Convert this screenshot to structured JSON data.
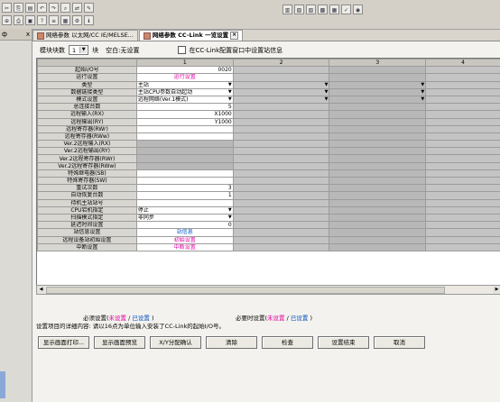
{
  "toolbar": {
    "left_icons": [
      "cut-icon",
      "copy-icon",
      "paste-icon",
      "undo-icon",
      "redo-icon",
      "find-icon",
      "replace-icon",
      "comment-icon",
      "zoom-icon",
      "print-icon",
      "save-icon",
      "help-icon",
      "list-icon",
      "grid-icon",
      "settings-icon",
      "info-icon"
    ],
    "right_icons": [
      "ladder-icon",
      "io-icon",
      "device-icon",
      "network-icon",
      "param-icon",
      "check-icon",
      "monitor-icon"
    ]
  },
  "left_pane": {
    "header": "ф x"
  },
  "tabs": [
    {
      "label": "网络参数 以太网/CC IE/MELSE...",
      "active": false
    },
    {
      "label": "网络参数 CC-Link 一览设置",
      "active": true
    }
  ],
  "top": {
    "module_count_label": "模块块数",
    "module_count_value": "1",
    "unit_label": "块",
    "blank_label": "空白:无设置",
    "checkbox_label": "在CC-Link配置窗口中设置站信息"
  },
  "columns": [
    "1",
    "2",
    "3",
    "4"
  ],
  "rows": [
    {
      "label": "起始I/O号",
      "c1": "0020",
      "type": "num"
    },
    {
      "label": "运行设置",
      "c1": "运行设置",
      "type": "pink"
    },
    {
      "label": "类型",
      "c1": "主站",
      "type": "dd"
    },
    {
      "label": "数据链接类型",
      "c1": "主站CPU参数自动起动",
      "type": "dd"
    },
    {
      "label": "模式设置",
      "c1": "远程网络(Ver.1模式)",
      "type": "dd"
    },
    {
      "label": "总连接台数",
      "c1": "5",
      "type": "num"
    },
    {
      "label": "远程输入(RX)",
      "c1": "X1000",
      "type": "num"
    },
    {
      "label": "远程输出(RY)",
      "c1": "Y1000",
      "type": "num"
    },
    {
      "label": "远程寄存器(RWr)",
      "c1": "",
      "type": "w"
    },
    {
      "label": "远程寄存器(RWw)",
      "c1": "",
      "type": "w"
    },
    {
      "label": "Ver.2远程输入(RX)",
      "c1": "",
      "type": "g"
    },
    {
      "label": "Ver.2远程输出(RY)",
      "c1": "",
      "type": "g"
    },
    {
      "label": "Ver.2远程寄存器(RWr)",
      "c1": "",
      "type": "g"
    },
    {
      "label": "Ver.2远程寄存器(RWw)",
      "c1": "",
      "type": "g"
    },
    {
      "label": "特殊继电器(SB)",
      "c1": "",
      "type": "w"
    },
    {
      "label": "特殊寄存器(SW)",
      "c1": "",
      "type": "w"
    },
    {
      "label": "重试次数",
      "c1": "3",
      "type": "num"
    },
    {
      "label": "自动恢复台数",
      "c1": "1",
      "type": "num"
    },
    {
      "label": "待机主站站号",
      "c1": "",
      "type": "w"
    },
    {
      "label": "CPU宕机指定",
      "c1": "停止",
      "type": "dd"
    },
    {
      "label": "扫描模式指定",
      "c1": "非同步",
      "type": "dd"
    },
    {
      "label": "延迟时间设置",
      "c1": "0",
      "type": "num"
    },
    {
      "label": "站信息设置",
      "c1": "站信息",
      "type": "blue"
    },
    {
      "label": "远程设备站初始设置",
      "c1": "初始设置",
      "type": "pink"
    },
    {
      "label": "中断设置",
      "c1": "中断设置",
      "type": "pink"
    }
  ],
  "legend": {
    "required_prefix": "必须设置(",
    "required_not": "未设置",
    "sep": " / ",
    "required_set": "已设置",
    "close": " )",
    "as_needed_prefix": "必要时设置(",
    "as_needed_not": "未设置",
    "as_needed_set": "已设置",
    "detail": "设置项目的详细内容:  请以16点为单位输入安装了CC-Link的起始I/O号。"
  },
  "buttons": [
    "显示画面打印...",
    "显示画面预览",
    "X/Y分配确认",
    "清除",
    "检查",
    "设置结束",
    "取消"
  ]
}
